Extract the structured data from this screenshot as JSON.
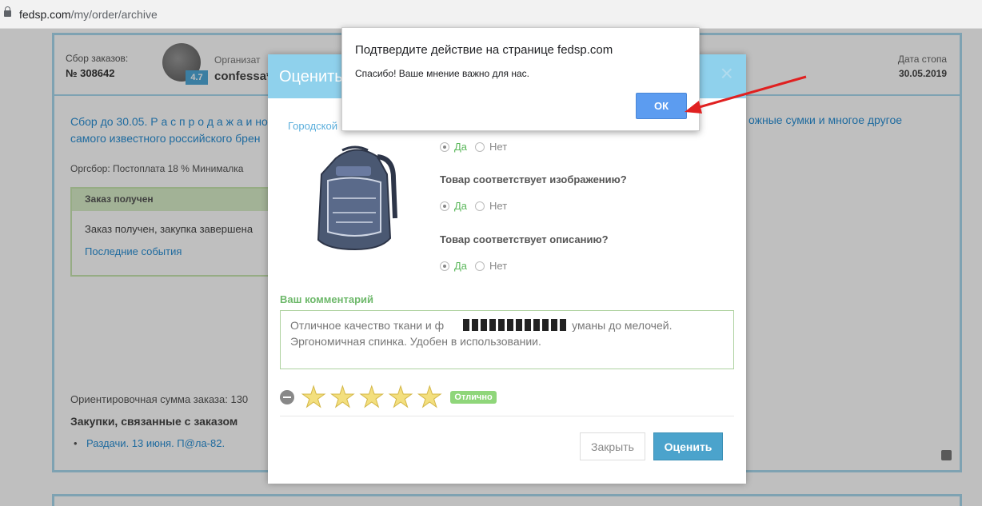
{
  "browser": {
    "url_domain": "fedsp.com",
    "url_path": "/my/order/archive"
  },
  "order": {
    "sbor_label": "Сбор заказов:",
    "sbor_number": "№ 308642",
    "org_label": "Организат",
    "org_name": "confessa*",
    "org_rating": "4.7",
    "date_label": "Дата стопа",
    "date_value": "30.05.2019",
    "description_left": "Сбор до 30.05. Р а с п р о д а ж а и но самого известного российского брен",
    "description_right": "ожные сумки и многое другое",
    "orgsbor": "Оргсбор: Постоплата 18 %   Минималка",
    "received": {
      "title": "Заказ получен",
      "text": "Заказ получен, закупка завершена",
      "link": "Последние события"
    },
    "sum_line": "Ориентировочная сумма заказа: 130",
    "related_title": "Закупки, связанные с заказом",
    "related_items": [
      "Раздачи. 13 июня. П@ла-82."
    ]
  },
  "modal": {
    "title": "Оценить",
    "close_glyph": "×",
    "product_link": "Городской",
    "questions": [
      {
        "text": "",
        "yes": "Да",
        "no": "Нет"
      },
      {
        "text": "Товар соответствует изображению?",
        "yes": "Да",
        "no": "Нет"
      },
      {
        "text": "Товар соответствует описанию?",
        "yes": "Да",
        "no": "Нет"
      }
    ],
    "comment_label": "Ваш комментарий",
    "comment_line1_start": "Отличное качество ткани и ф",
    "comment_line1_end": "уманы до мелочей.",
    "comment_line2": "Эргономичная спинка. Удобен в использовании.",
    "rating_stars": 5,
    "rating_badge": "Отлично",
    "btn_close": "Закрыть",
    "btn_rate": "Оценить"
  },
  "dialog": {
    "title": "Подтвердите действие на странице fedsp.com",
    "message": "Спасибо! Ваше мнение важно для нас.",
    "ok_label": "ОК"
  },
  "colors": {
    "accent_blue": "#8fd1ec",
    "dialog_ok": "#5c9cf0",
    "annotation_arrow": "#e02020"
  }
}
